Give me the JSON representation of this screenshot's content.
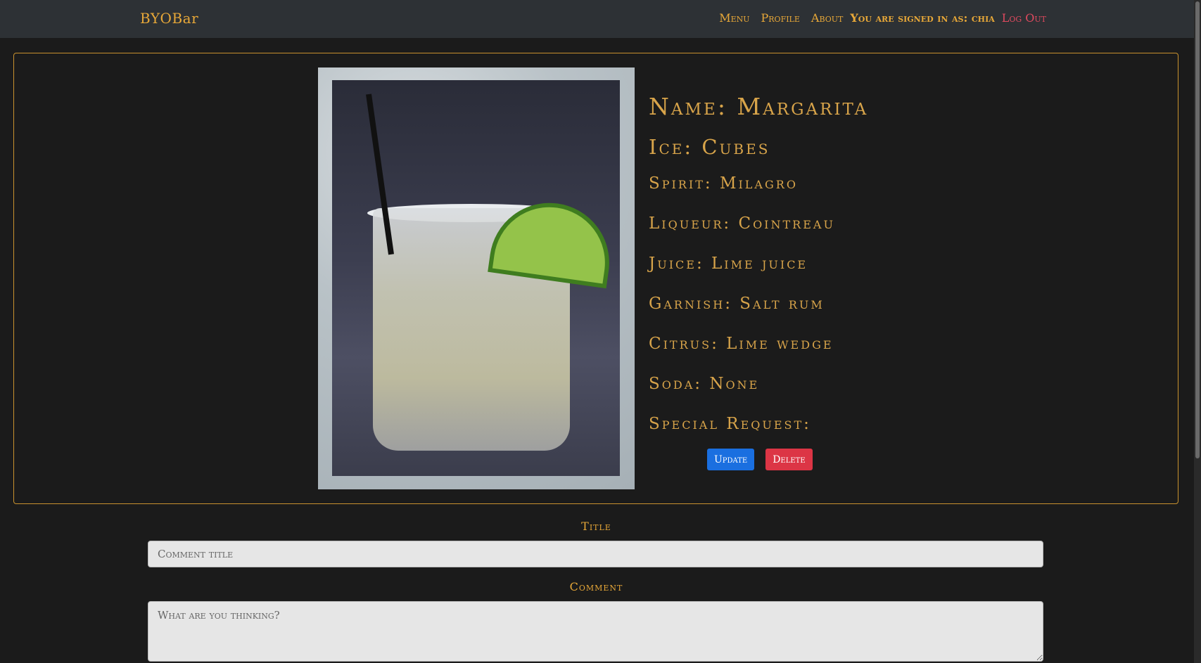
{
  "navbar": {
    "brand": "BYOBar",
    "links": [
      "Menu",
      "Profile",
      "About"
    ],
    "signed_in": "You are signed in as: chia",
    "logout": "Log Out"
  },
  "drink": {
    "name": "Name: Margarita",
    "ice": "Ice: Cubes",
    "spirit": "Spirit: Milagro",
    "liqueur": "Liqueur: Cointreau",
    "juice": "Juice: Lime juice",
    "garnish": "Garnish: Salt rum",
    "citrus": "Citrus: Lime wedge",
    "soda": "Soda: None",
    "special_request": "Special Request:"
  },
  "actions": {
    "update": "Update",
    "delete": "Delete"
  },
  "comment_form": {
    "title_label": "Title",
    "title_placeholder": "Comment title",
    "comment_label": "Comment",
    "comment_placeholder": "What are you thinking?"
  },
  "colors": {
    "accent": "#e8a838",
    "navbar": "#2d3135",
    "background": "#1b1b1b",
    "logout": "#e04a5f",
    "update": "#1a6fe0",
    "delete": "#dc3545"
  }
}
